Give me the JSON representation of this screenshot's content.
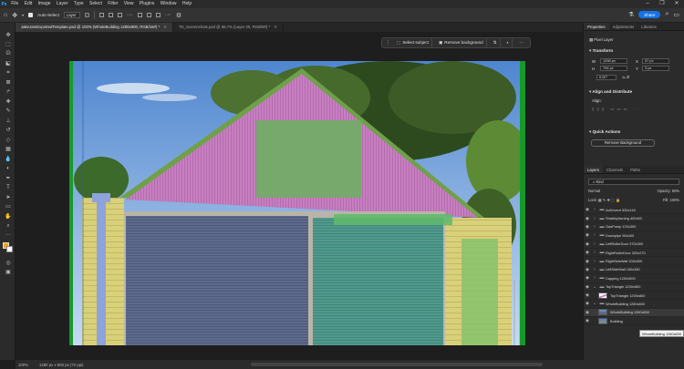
{
  "menu": {
    "logo": "Ps",
    "items": [
      "File",
      "Edit",
      "Image",
      "Layer",
      "Type",
      "Select",
      "Filter",
      "View",
      "Plugins",
      "Window",
      "Help"
    ]
  },
  "options": {
    "auto_select_label": "Auto-Select",
    "auto_select_target": "Layer",
    "share_label": "Share"
  },
  "tabs": [
    {
      "label": "JakeJamExportedTemplate.psd @ 100% (WholeBuilding 1280x800, RGB/16#) *",
      "active": true
    },
    {
      "label": "TD_Screenshots.psd @ 66.7% (Layer 20, RGB/8#) *",
      "active": false
    }
  ],
  "context_bar": {
    "select_subject": "Select subject",
    "remove_background": "Remove background"
  },
  "status": {
    "zoom": "100%",
    "doc_info": "1280 px x 800 px (72 ppi)"
  },
  "properties": {
    "tabs": [
      "Properties",
      "Adjustments",
      "Libraries"
    ],
    "layer_type": "Pixel Layer",
    "transform_title": "Transform",
    "w_label": "W",
    "w_value": "1258 px",
    "x_label": "X",
    "x_value": "37 px",
    "h_label": "H",
    "h_value": "794 px",
    "y_label": "Y",
    "y_value": "3 px",
    "angle_value": "0.00°",
    "align_title": "Align and Distribute",
    "align_label": "Align:",
    "quick_actions_title": "Quick Actions",
    "remove_bg_button": "Remove Background"
  },
  "layers_panel": {
    "tabs": [
      "Layers",
      "Channels",
      "Paths"
    ],
    "filter_label": "Kind",
    "blend_mode": "Normal",
    "opacity_label": "Opacity:",
    "opacity_value": "50%",
    "lock_label": "Lock:",
    "fill_label": "Fill:",
    "fill_value": "100%",
    "layers": [
      {
        "name": "AcDrivent 320x140",
        "type": "folder",
        "selected": false
      },
      {
        "name": "ShabbyAwning 400x60",
        "type": "folder",
        "selected": false
      },
      {
        "name": "GasPump 120x300",
        "type": "folder",
        "selected": false
      },
      {
        "name": "Downpipe 90x400",
        "type": "folder",
        "selected": false
      },
      {
        "name": "LeftRollerDoor 370x300",
        "type": "folder",
        "selected": false
      },
      {
        "name": "RightRollerDoor 320x270",
        "type": "folder",
        "selected": false
      },
      {
        "name": "RightSideWall 200x300",
        "type": "folder",
        "selected": false
      },
      {
        "name": "LeftSideWall 150x350",
        "type": "folder",
        "selected": false
      },
      {
        "name": "Capping 1200x500",
        "type": "folder",
        "selected": false
      },
      {
        "name": "TopTriangle 1200x800",
        "type": "folder",
        "selected": false
      },
      {
        "name": "TopTriangle 1200x800",
        "type": "layer",
        "selected": false
      },
      {
        "name": "WholeBuilding 1280x800",
        "type": "folder",
        "selected": false
      },
      {
        "name": "WholeBuilding 1280x800",
        "type": "layer",
        "selected": true
      },
      {
        "name": "Building",
        "type": "layer",
        "selected": false
      }
    ],
    "tooltip": "WholeBuilding 1280x800"
  },
  "colors": {
    "foreground": "#f3a21c",
    "accent": "#1473e6"
  }
}
